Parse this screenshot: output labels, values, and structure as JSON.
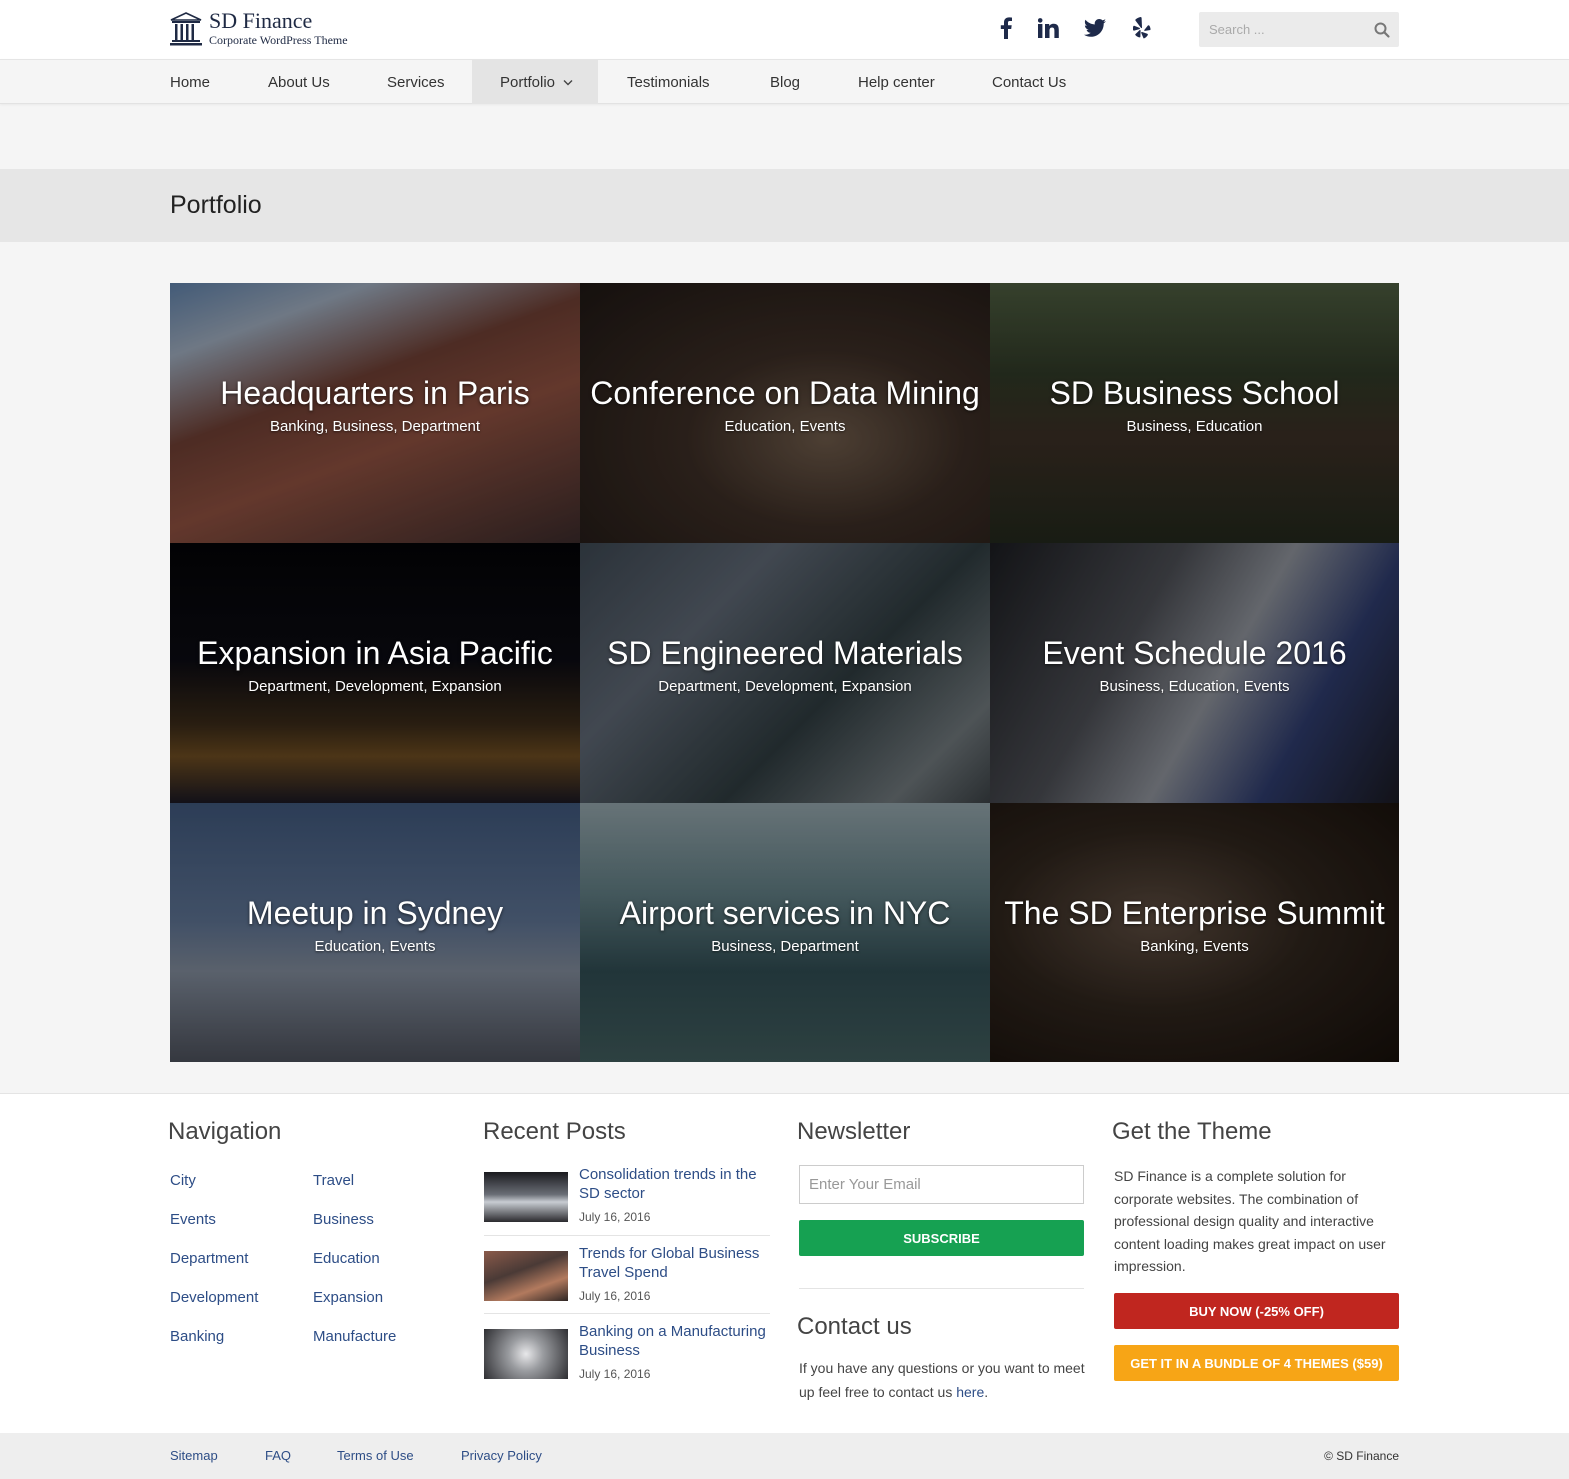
{
  "brand": {
    "title": "SD Finance",
    "tagline": "Corporate WordPress Theme"
  },
  "social": [
    {
      "icon": "facebook-icon"
    },
    {
      "icon": "linkedin-icon"
    },
    {
      "icon": "twitter-icon"
    },
    {
      "icon": "yelp-icon"
    }
  ],
  "search": {
    "placeholder": "Search ..."
  },
  "nav": {
    "items": [
      "Home",
      "About Us",
      "Services",
      "Portfolio",
      "Testimonials",
      "Blog",
      "Help center",
      "Contact Us"
    ],
    "active": "Portfolio"
  },
  "page": {
    "title": "Portfolio"
  },
  "portfolio": [
    {
      "title": "Headquarters in Paris",
      "cats": "Banking, Business, Department"
    },
    {
      "title": "Conference on Data Mining",
      "cats": "Education, Events"
    },
    {
      "title": "SD Business School",
      "cats": "Business, Education"
    },
    {
      "title": "Expansion in Asia Pacific",
      "cats": "Department, Development, Expansion"
    },
    {
      "title": "SD Engineered Materials",
      "cats": "Department, Development, Expansion"
    },
    {
      "title": "Event Schedule 2016",
      "cats": "Business, Education, Events"
    },
    {
      "title": "Meetup in Sydney",
      "cats": "Education, Events"
    },
    {
      "title": "Airport services in NYC",
      "cats": "Business, Department"
    },
    {
      "title": "The SD Enterprise Summit",
      "cats": "Banking, Events"
    }
  ],
  "footer": {
    "navigation": {
      "title": "Navigation",
      "col1": [
        "City",
        "Events",
        "Department",
        "Development",
        "Banking"
      ],
      "col2": [
        "Travel",
        "Business",
        "Education",
        "Expansion",
        "Manufacture"
      ]
    },
    "recent_posts": {
      "title": "Recent Posts",
      "posts": [
        {
          "title": "Consolidation trends in the SD sector",
          "date": "July 16, 2016"
        },
        {
          "title": "Trends for Global Business Travel Spend",
          "date": "July 16, 2016"
        },
        {
          "title": "Banking on a Manufacturing Business",
          "date": "July 16, 2016"
        }
      ]
    },
    "newsletter": {
      "title": "Newsletter",
      "placeholder": "Enter Your Email",
      "button": "SUBSCRIBE"
    },
    "contact": {
      "title": "Contact us",
      "text": "If you have any questions or you want to meet up feel free to contact us ",
      "link": "here",
      "end": "."
    },
    "theme": {
      "title": "Get the Theme",
      "text": "SD Finance is a complete solution for corporate websites. The combination of professional design quality and interactive content loading makes great impact on user impression.",
      "buy_button": "BUY NOW (-25% OFF)",
      "bundle_button": "GET IT IN A BUNDLE OF 4 THEMES ($59)"
    }
  },
  "bottom": {
    "links": [
      "Sitemap",
      "FAQ",
      "Terms of Use",
      "Privacy Policy"
    ],
    "copyright": "© SD Finance"
  },
  "colors": {
    "link": "#2d4d86",
    "subscribe": "#16a152",
    "buy": "#c0261f",
    "bundle": "#f7a516",
    "brand_navy": "#1f2a44"
  }
}
